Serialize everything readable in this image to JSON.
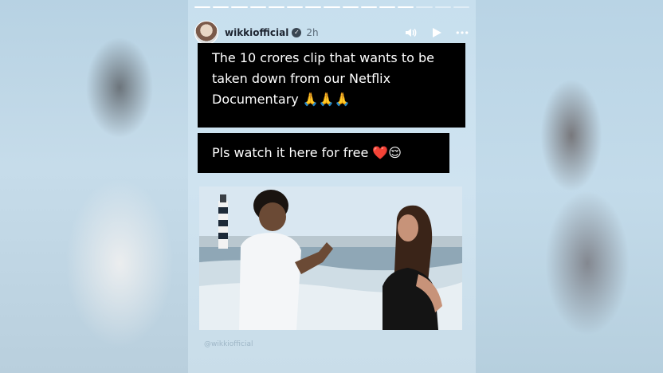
{
  "story": {
    "username": "wikkiofficial",
    "time_ago": "2h",
    "caption_1": "The 10 crores clip that wants to be taken down from our Netflix Documentary 🙏🙏🙏",
    "caption_2": "Pls watch it here for free ❤️😌",
    "watermark": "@wikkiofficial"
  },
  "progress": {
    "segments_total": 15,
    "segments_done": 12
  },
  "icons": {
    "verified": "verified-badge-icon",
    "sound": "speaker-icon",
    "play": "play-icon",
    "more": "more-options-icon"
  }
}
